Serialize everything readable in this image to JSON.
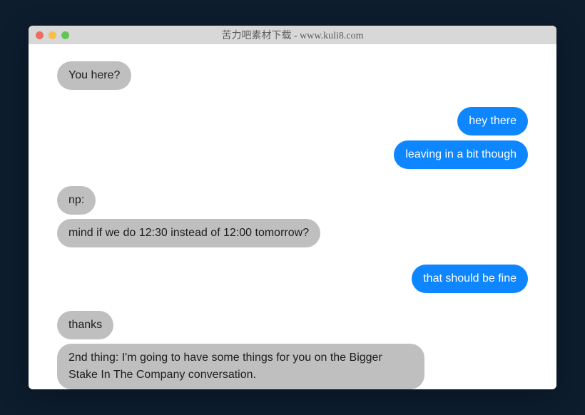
{
  "window": {
    "title": "苦力吧素材下载 - www.kuli8.com"
  },
  "messages": {
    "m0": {
      "text": "You here?"
    },
    "m1": {
      "text": "hey there"
    },
    "m2": {
      "text": "leaving in a bit though"
    },
    "m3": {
      "text": "np:"
    },
    "m4": {
      "text": "mind if we do 12:30 instead of 12:00 tomorrow?"
    },
    "m5": {
      "text": "that should be fine"
    },
    "m6": {
      "text": "thanks"
    },
    "m7": {
      "text": "2nd thing: I'm going to have some things for you on the Bigger Stake In The Company conversation."
    }
  }
}
